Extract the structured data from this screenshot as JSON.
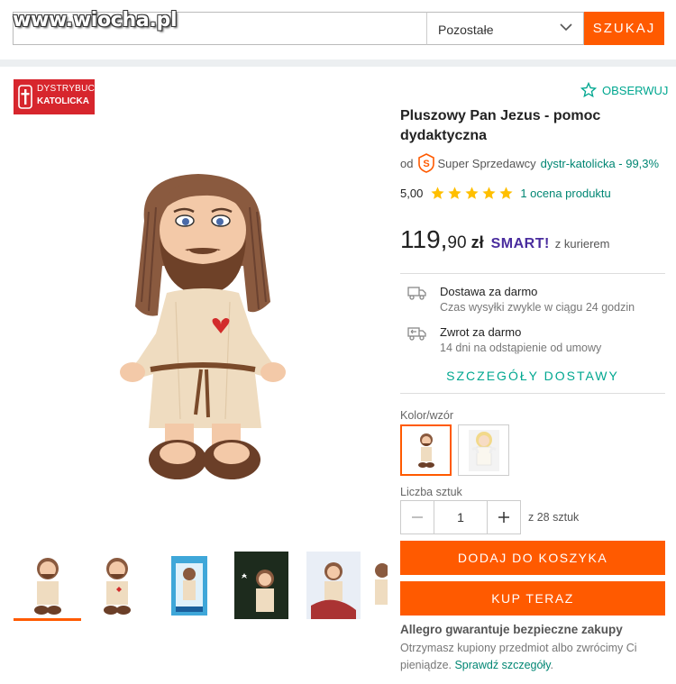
{
  "watermark": "www.wiocha.pl",
  "search": {
    "input_value": "",
    "category_selected": "Pozostałe",
    "button_label": "SZUKAJ"
  },
  "seller_logo": {
    "line1": "DYSTRYBUCJA",
    "line2": "KATOLICKA"
  },
  "observe_label": "OBSERWUJ",
  "product": {
    "title": "Pluszowy Pan Jezus - pomoc dydaktyczna",
    "seller_prefix": "od",
    "seller_badge": "Super Sprzedawcy",
    "seller_name": "dystr-katolicka - 99,3%",
    "rating_value": "5,00",
    "rating_stars": 5,
    "rating_count": "1 ocena produktu",
    "price_int": "119,",
    "price_dec": "90",
    "currency": "zł",
    "smart_label": "SMART!",
    "smart_note": "z kurierem"
  },
  "shipping": {
    "delivery_title": "Dostawa za darmo",
    "delivery_sub": "Czas wysyłki zwykle w ciągu 24 godzin",
    "return_title": "Zwrot za darmo",
    "return_sub": "14 dni na odstąpienie od umowy",
    "details_link": "SZCZEGÓŁY DOSTAWY"
  },
  "variant_label": "Kolor/wzór",
  "quantity": {
    "label": "Liczba sztuk",
    "value": "1",
    "available": "z 28 sztuk"
  },
  "buttons": {
    "add_to_cart": "DODAJ DO KOSZYKA",
    "buy_now": "KUP TERAZ"
  },
  "guarantee": {
    "title": "Allegro gwarantuje bezpieczne zakupy",
    "text": "Otrzymasz kupiony przedmiot albo zwrócimy Ci pieniądze. ",
    "link": "Sprawdź szczegóły",
    "suffix": "."
  },
  "colors": {
    "accent": "#ff5a00",
    "link": "#008673",
    "star": "#ffbf00",
    "smart": "#4a2d9e"
  }
}
